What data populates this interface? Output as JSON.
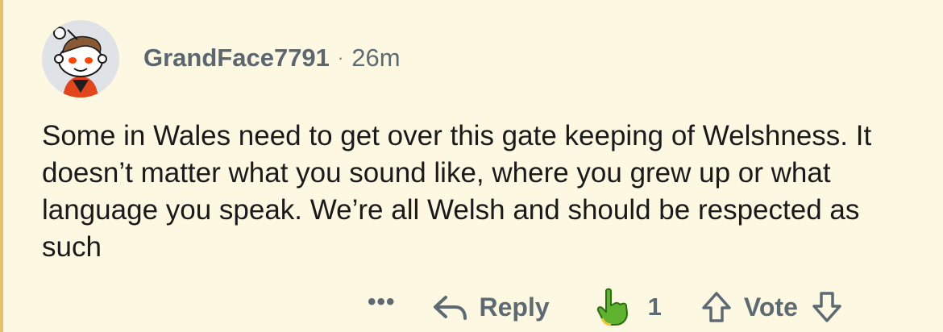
{
  "comment": {
    "username": "GrandFace7791",
    "separator": "·",
    "time": "26m",
    "body": "Some in Wales need to get over this gate keeping of Welshness. It doesn’t matter what you sound like, where you grew up or what language you speak. We’re all Welsh and should be respected as such"
  },
  "actions": {
    "more_label": "•••",
    "reply_label": "Reply",
    "award_count": "1",
    "vote_label": "Vote"
  },
  "icons": {
    "avatar": "reddit-snoo-avatar-icon",
    "reply": "reply-arrow-icon",
    "award": "pointing-finger-award-icon",
    "upvote": "upvote-arrow-icon",
    "downvote": "downvote-arrow-icon"
  },
  "colors": {
    "background": "#fdf8e1",
    "thread_line": "#e3c26a",
    "meta_text": "#5d6a73",
    "body_text": "#1a1a1b",
    "award_green": "#5fb32e"
  }
}
